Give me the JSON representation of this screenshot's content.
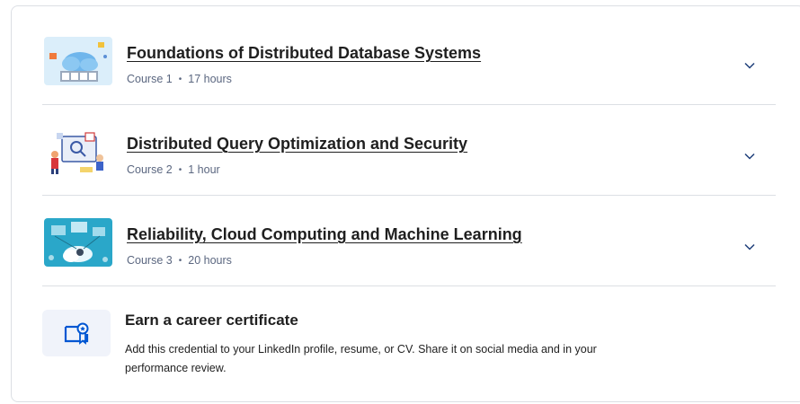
{
  "courses": [
    {
      "title": "Foundations of Distributed Database Systems",
      "course_label": "Course 1",
      "duration": "17 hours"
    },
    {
      "title": "Distributed Query Optimization and Security",
      "course_label": "Course 2",
      "duration": "1 hour"
    },
    {
      "title": "Reliability, Cloud Computing and Machine Learning",
      "course_label": "Course 3",
      "duration": "20 hours"
    }
  ],
  "certificate": {
    "title": "Earn a career certificate",
    "description": "Add this credential to your LinkedIn profile, resume, or CV. Share it on social media and in your performance review."
  },
  "colors": {
    "accent": "#0056d2",
    "meta_text": "#5b6780",
    "divider": "#dcdfe4"
  }
}
